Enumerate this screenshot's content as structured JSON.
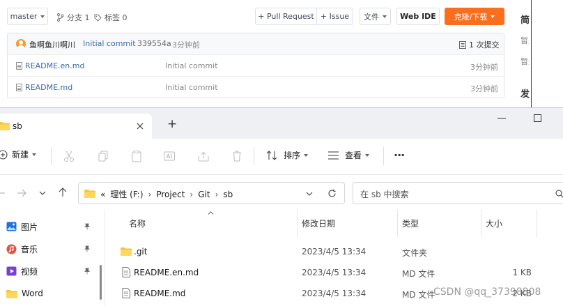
{
  "repo_header": {
    "branch": "master",
    "branches_label": "分支 1",
    "tags_label": "标签 0",
    "pull_request_label": "+ Pull Request",
    "issue_label": "+ Issue",
    "files_label": "文件",
    "web_ide_label": "Web IDE",
    "clone_label": "克隆/下载"
  },
  "side_panel": {
    "heading1": "简",
    "text1": "暂无",
    "heading2": "发"
  },
  "commit_bar": {
    "author": "鱼啊鱼川啊川",
    "message": "Initial commit",
    "hash": "339554a",
    "time": "3分钟前",
    "commits_label": "1 次提交"
  },
  "repo_files": [
    {
      "name": "README.en.md",
      "commit": "Initial commit",
      "time": "3分钟前"
    },
    {
      "name": "README.md",
      "commit": "Initial commit",
      "time": "3分钟前"
    }
  ],
  "explorer": {
    "tab_title": "sb",
    "new_tab_symbol": "+",
    "new_label": "新建",
    "sort_label": "排序",
    "view_label": "查看",
    "more_symbol": "···",
    "breadcrumb": [
      "«",
      "理性 (F:)",
      "Project",
      "Git",
      "sb"
    ],
    "search_placeholder": "在 sb 中搜索",
    "nav_items": [
      {
        "label": "图片",
        "icon": "pictures-icon",
        "color": "#1e73d8"
      },
      {
        "label": "音乐",
        "icon": "music-icon",
        "color": "#e0533d"
      },
      {
        "label": "视频",
        "icon": "video-icon",
        "color": "#7b3fd1"
      },
      {
        "label": "Word",
        "icon": "folder-icon",
        "color": "#f5c440"
      }
    ],
    "columns": [
      "名称",
      "修改日期",
      "类型",
      "大小"
    ],
    "files": [
      {
        "name": ".git",
        "date": "2023/4/5 13:34",
        "type": "文件夹",
        "size": "",
        "icon": "folder-icon"
      },
      {
        "name": "README.en.md",
        "date": "2023/4/5 13:34",
        "type": "MD 文件",
        "size": "1 KB",
        "icon": "file-icon"
      },
      {
        "name": "README.md",
        "date": "2023/4/5 13:34",
        "type": "MD 文件",
        "size": "2 KB",
        "icon": "file-icon"
      }
    ]
  },
  "watermark": "CSDN @qq_37398808",
  "colors": {
    "accent_orange": "#fa6e1e",
    "link_blue": "#3d6ba3",
    "folder_yellow": "#f5c440"
  }
}
